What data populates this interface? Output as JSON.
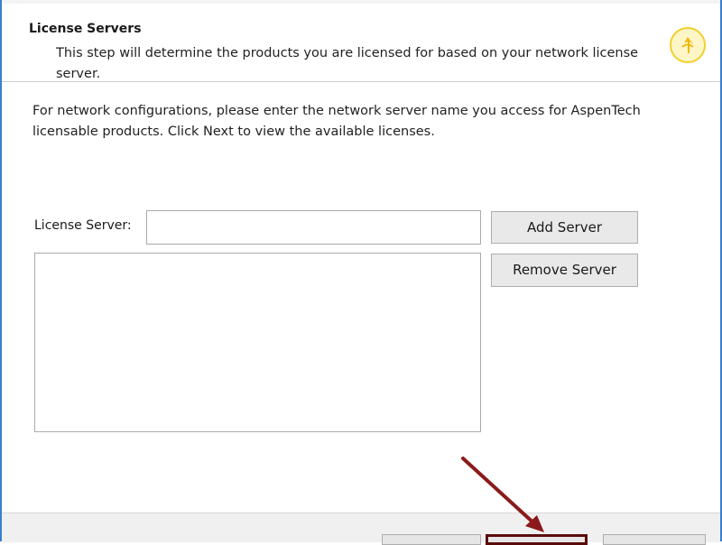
{
  "header": {
    "title": "License Servers",
    "description": "This step will determine the products you are licensed for based on your network license server."
  },
  "body": {
    "instructions": "For network configurations, please enter the network server name you access for AspenTech licensable products.  Click Next to view the available licenses."
  },
  "license_server": {
    "label": "License Server:",
    "value": "",
    "servers": []
  },
  "buttons": {
    "add": "Add Server",
    "remove": "Remove Server"
  },
  "annotation": {
    "arrow_color": "#8b1a1a"
  },
  "colors": {
    "window_border": "#3b7fd0",
    "logo_ring": "#f2cf2c"
  }
}
